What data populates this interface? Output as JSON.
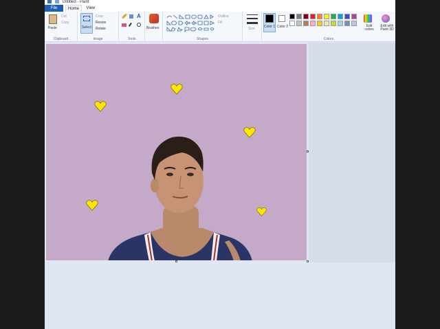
{
  "window": {
    "title": "Untitled - Paint"
  },
  "tabs": {
    "file": "File",
    "home": "Home",
    "view": "View"
  },
  "clipboard": {
    "paste": "Paste",
    "cut": "Cut",
    "copy": "Copy",
    "group": "Clipboard"
  },
  "image": {
    "select": "Select",
    "crop": "Crop",
    "resize": "Resize",
    "rotate": "Rotate",
    "group": "Image"
  },
  "tools": {
    "group": "Tools",
    "brushes": "Brushes"
  },
  "shapes": {
    "outline": "Outline",
    "fill": "Fill",
    "group": "Shapes"
  },
  "size": {
    "label": "Size"
  },
  "colors": {
    "color1": "Color 1",
    "color2": "Color 2",
    "edit": "Edit colors",
    "paint3d": "Edit with Paint 3D",
    "group": "Colors",
    "color1_value": "#000000",
    "color2_value": "#ffffff",
    "palette_row1": [
      "#000000",
      "#7f7f7f",
      "#880015",
      "#ed1c24",
      "#ff7f27",
      "#fff200",
      "#22b14c",
      "#00a2e8",
      "#3f48cc",
      "#a349a4"
    ],
    "palette_row2": [
      "#ffffff",
      "#c3c3c3",
      "#b97a57",
      "#ffaec9",
      "#ffc90e",
      "#efe4b0",
      "#b5e61d",
      "#99d9ea",
      "#7092be",
      "#c8bfe7"
    ]
  },
  "canvas": {
    "background": "#c4a9c8",
    "heart_color": "#ffe600"
  }
}
